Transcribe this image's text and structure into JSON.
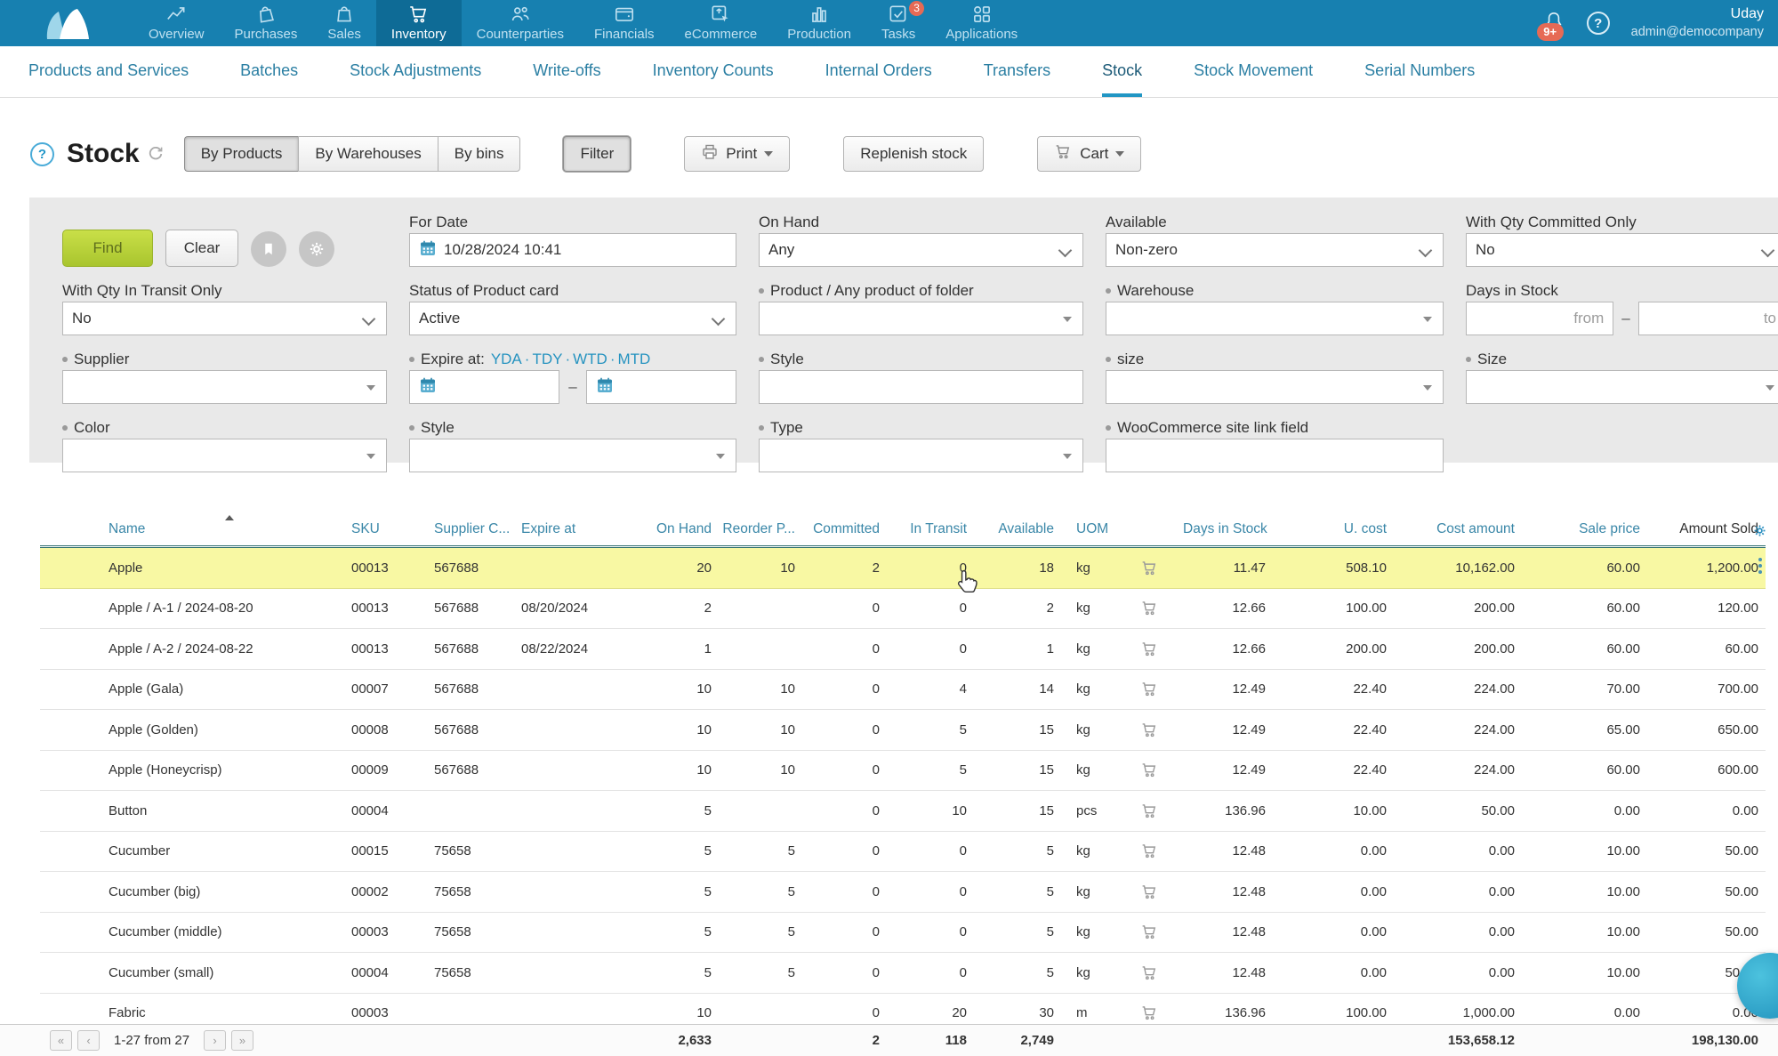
{
  "topnav": {
    "items": [
      {
        "label": "Overview",
        "icon": "chart-line",
        "active": false
      },
      {
        "label": "Purchases",
        "icon": "bag-tilt",
        "active": false
      },
      {
        "label": "Sales",
        "icon": "bag",
        "active": false
      },
      {
        "label": "Inventory",
        "icon": "cart",
        "active": true
      },
      {
        "label": "Counterparties",
        "icon": "people",
        "active": false
      },
      {
        "label": "Financials",
        "icon": "wallet",
        "active": false
      },
      {
        "label": "eCommerce",
        "icon": "box-arrow",
        "active": false
      },
      {
        "label": "Production",
        "icon": "bar-chart",
        "active": false
      },
      {
        "label": "Tasks",
        "icon": "task-check",
        "active": false,
        "badge": "3"
      },
      {
        "label": "Applications",
        "icon": "app-grid",
        "active": false
      }
    ],
    "notifications": "9+",
    "user": {
      "name": "Uday",
      "email": "admin@democompany"
    }
  },
  "subnav": {
    "items": [
      "Products and Services",
      "Batches",
      "Stock Adjustments",
      "Write-offs",
      "Inventory Counts",
      "Internal Orders",
      "Transfers",
      "Stock",
      "Stock Movement",
      "Serial Numbers"
    ],
    "active_index": 7
  },
  "toolbar": {
    "help": "?",
    "title": "Stock",
    "views": [
      "By Products",
      "By Warehouses",
      "By bins"
    ],
    "active_view": 0,
    "filter_label": "Filter",
    "print_label": "Print",
    "replenish_label": "Replenish stock",
    "cart_label": "Cart"
  },
  "filters": {
    "find": "Find",
    "clear": "Clear",
    "for_date": {
      "label": "For Date",
      "value": "10/28/2024 10:41"
    },
    "on_hand": {
      "label": "On Hand",
      "value": "Any"
    },
    "available": {
      "label": "Available",
      "value": "Non-zero"
    },
    "qty_committed": {
      "label": "With Qty Committed Only",
      "value": "No"
    },
    "qty_transit": {
      "label": "With Qty In Transit Only",
      "value": "No"
    },
    "status": {
      "label": "Status of Product card",
      "value": "Active"
    },
    "product": {
      "label": "Product / Any product of folder",
      "value": ""
    },
    "warehouse": {
      "label": "Warehouse",
      "value": ""
    },
    "days_in_stock": {
      "label": "Days in Stock",
      "from_placeholder": "from",
      "to_placeholder": "to"
    },
    "supplier": {
      "label": "Supplier",
      "value": ""
    },
    "expire": {
      "label": "Expire at:",
      "links": [
        "YDA",
        "TDY",
        "WTD",
        "MTD"
      ],
      "value_from": "",
      "value_to": ""
    },
    "style_row3": {
      "label": "Style",
      "value": ""
    },
    "size_lower": {
      "label": "size",
      "value": ""
    },
    "size_upper": {
      "label": "Size",
      "value": ""
    },
    "color": {
      "label": "Color",
      "value": ""
    },
    "style_row4": {
      "label": "Style",
      "value": ""
    },
    "type": {
      "label": "Type",
      "value": ""
    },
    "woocommerce": {
      "label": "WooCommerce site link field",
      "value": ""
    }
  },
  "table": {
    "columns": [
      {
        "key": "name",
        "label": "Name"
      },
      {
        "key": "sku",
        "label": "SKU"
      },
      {
        "key": "supplier",
        "label": "Supplier C..."
      },
      {
        "key": "expire",
        "label": "Expire at"
      },
      {
        "key": "onhand",
        "label": "On Hand"
      },
      {
        "key": "reorder",
        "label": "Reorder P..."
      },
      {
        "key": "committed",
        "label": "Committed"
      },
      {
        "key": "intransit",
        "label": "In Transit"
      },
      {
        "key": "available",
        "label": "Available"
      },
      {
        "key": "uom",
        "label": "UOM"
      },
      {
        "key": "cart",
        "label": ""
      },
      {
        "key": "days",
        "label": "Days in Stock"
      },
      {
        "key": "ucost",
        "label": "U. cost"
      },
      {
        "key": "costamt",
        "label": "Cost amount"
      },
      {
        "key": "saleprice",
        "label": "Sale price"
      },
      {
        "key": "amountsold",
        "label": "Amount Sold"
      }
    ],
    "rows": [
      {
        "name": "Apple",
        "sku": "00013",
        "supplier": "567688",
        "expire": "",
        "onhand": "20",
        "reorder": "10",
        "committed": "2",
        "intransit": "0",
        "available": "18",
        "uom": "kg",
        "days": "11.47",
        "ucost": "508.10",
        "costamt": "10,162.00",
        "saleprice": "60.00",
        "amountsold": "1,200.00",
        "highlighted": true
      },
      {
        "name": "Apple / A-1 / 2024-08-20",
        "sku": "00013",
        "supplier": "567688",
        "expire": "08/20/2024",
        "onhand": "2",
        "reorder": "",
        "committed": "0",
        "intransit": "0",
        "available": "2",
        "uom": "kg",
        "days": "12.66",
        "ucost": "100.00",
        "costamt": "200.00",
        "saleprice": "60.00",
        "amountsold": "120.00"
      },
      {
        "name": "Apple / A-2 / 2024-08-22",
        "sku": "00013",
        "supplier": "567688",
        "expire": "08/22/2024",
        "onhand": "1",
        "reorder": "",
        "committed": "0",
        "intransit": "0",
        "available": "1",
        "uom": "kg",
        "days": "12.66",
        "ucost": "200.00",
        "costamt": "200.00",
        "saleprice": "60.00",
        "amountsold": "60.00"
      },
      {
        "name": "Apple (Gala)",
        "sku": "00007",
        "supplier": "567688",
        "expire": "",
        "onhand": "10",
        "reorder": "10",
        "committed": "0",
        "intransit": "4",
        "available": "14",
        "uom": "kg",
        "days": "12.49",
        "ucost": "22.40",
        "costamt": "224.00",
        "saleprice": "70.00",
        "amountsold": "700.00"
      },
      {
        "name": "Apple (Golden)",
        "sku": "00008",
        "supplier": "567688",
        "expire": "",
        "onhand": "10",
        "reorder": "10",
        "committed": "0",
        "intransit": "5",
        "available": "15",
        "uom": "kg",
        "days": "12.49",
        "ucost": "22.40",
        "costamt": "224.00",
        "saleprice": "65.00",
        "amountsold": "650.00"
      },
      {
        "name": "Apple (Honeycrisp)",
        "sku": "00009",
        "supplier": "567688",
        "expire": "",
        "onhand": "10",
        "reorder": "10",
        "committed": "0",
        "intransit": "5",
        "available": "15",
        "uom": "kg",
        "days": "12.49",
        "ucost": "22.40",
        "costamt": "224.00",
        "saleprice": "60.00",
        "amountsold": "600.00"
      },
      {
        "name": "Button",
        "sku": "00004",
        "supplier": "",
        "expire": "",
        "onhand": "5",
        "reorder": "",
        "committed": "0",
        "intransit": "10",
        "available": "15",
        "uom": "pcs",
        "days": "136.96",
        "ucost": "10.00",
        "costamt": "50.00",
        "saleprice": "0.00",
        "amountsold": "0.00"
      },
      {
        "name": "Cucumber",
        "sku": "00015",
        "supplier": "75658",
        "expire": "",
        "onhand": "5",
        "reorder": "5",
        "committed": "0",
        "intransit": "0",
        "available": "5",
        "uom": "kg",
        "days": "12.48",
        "ucost": "0.00",
        "costamt": "0.00",
        "saleprice": "10.00",
        "amountsold": "50.00"
      },
      {
        "name": "Cucumber (big)",
        "sku": "00002",
        "supplier": "75658",
        "expire": "",
        "onhand": "5",
        "reorder": "5",
        "committed": "0",
        "intransit": "0",
        "available": "5",
        "uom": "kg",
        "days": "12.48",
        "ucost": "0.00",
        "costamt": "0.00",
        "saleprice": "10.00",
        "amountsold": "50.00"
      },
      {
        "name": "Cucumber (middle)",
        "sku": "00003",
        "supplier": "75658",
        "expire": "",
        "onhand": "5",
        "reorder": "5",
        "committed": "0",
        "intransit": "0",
        "available": "5",
        "uom": "kg",
        "days": "12.48",
        "ucost": "0.00",
        "costamt": "0.00",
        "saleprice": "10.00",
        "amountsold": "50.00"
      },
      {
        "name": "Cucumber (small)",
        "sku": "00004",
        "supplier": "75658",
        "expire": "",
        "onhand": "5",
        "reorder": "5",
        "committed": "0",
        "intransit": "0",
        "available": "5",
        "uom": "kg",
        "days": "12.48",
        "ucost": "0.00",
        "costamt": "0.00",
        "saleprice": "10.00",
        "amountsold": "50.00"
      },
      {
        "name": "Fabric",
        "sku": "00003",
        "supplier": "",
        "expire": "",
        "onhand": "10",
        "reorder": "",
        "committed": "0",
        "intransit": "20",
        "available": "30",
        "uom": "m",
        "days": "136.96",
        "ucost": "100.00",
        "costamt": "1,000.00",
        "saleprice": "0.00",
        "amountsold": "0.00"
      }
    ]
  },
  "footer": {
    "pagination": "1-27 from 27",
    "totals": {
      "onhand": "2,633",
      "committed": "2",
      "intransit": "118",
      "available": "2,749",
      "costamt": "153,658.12",
      "amountsold": "198,130.00"
    }
  },
  "colors": {
    "topbar": "#1780b0",
    "topbar_active": "#0e6b96",
    "accent_teal": "#2b7fa3",
    "highlight_row": "#f8f8a3",
    "find_button": "#b4cf3a",
    "badge_red": "#e66a55"
  }
}
